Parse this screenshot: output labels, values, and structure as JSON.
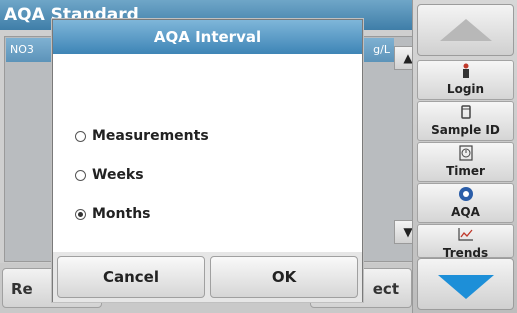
{
  "background": {
    "title": "AQA Standard",
    "table_header_left": "NO3",
    "table_header_unit": "g/L",
    "bottom_left_label": "Re",
    "bottom_right_label": "ect"
  },
  "sidebar": {
    "login_label": "Login",
    "login_icon": "person-icon",
    "sample_label": "Sample ID",
    "sample_icon": "container-icon",
    "timer_label": "Timer",
    "timer_icon": "timer-icon",
    "aqa_label": "AQA",
    "aqa_icon": "aqa-icon",
    "trends_label": "Trends",
    "trends_icon": "trend-chart-icon"
  },
  "dialog": {
    "title": "AQA Interval",
    "options": [
      {
        "label": "Measurements",
        "selected": false
      },
      {
        "label": "Weeks",
        "selected": false
      },
      {
        "label": "Months",
        "selected": true
      }
    ],
    "cancel_label": "Cancel",
    "ok_label": "OK"
  },
  "colors": {
    "title_bar": "#3e85b6",
    "scroll_down_accent": "#1d8fd8"
  }
}
